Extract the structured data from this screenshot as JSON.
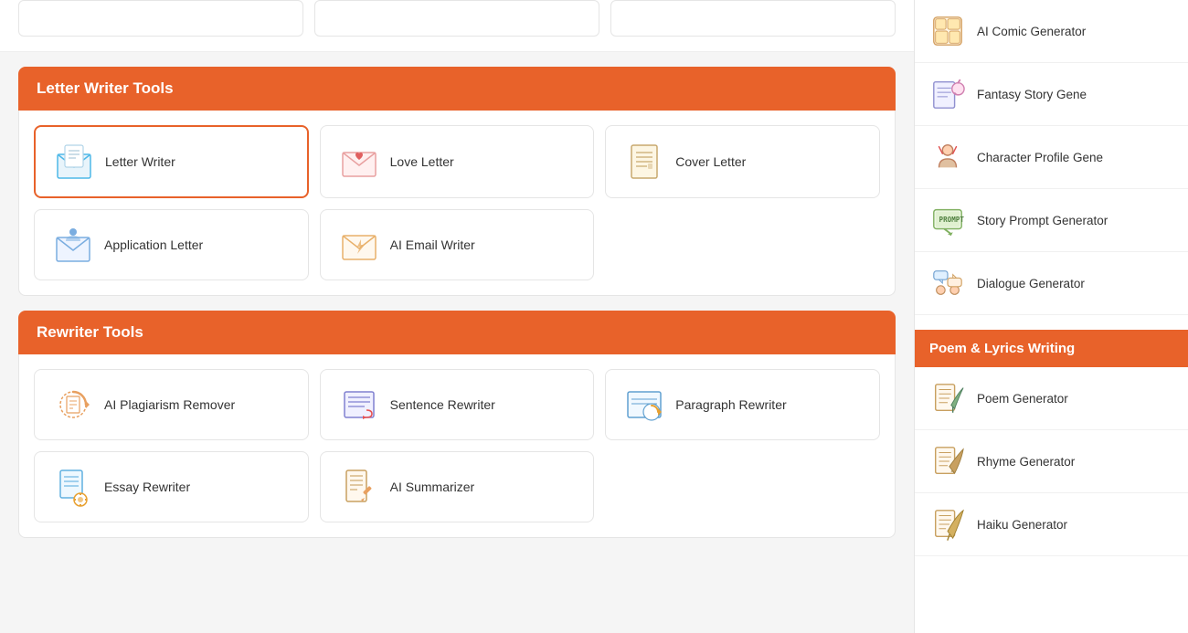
{
  "topCards": [
    {
      "id": "card1"
    },
    {
      "id": "card2"
    },
    {
      "id": "card3"
    }
  ],
  "letterSection": {
    "header": "Letter Writer Tools",
    "tools": [
      {
        "id": "letter-writer",
        "label": "Letter Writer",
        "active": true
      },
      {
        "id": "love-letter",
        "label": "Love Letter",
        "active": false
      },
      {
        "id": "cover-letter",
        "label": "Cover Letter",
        "active": false
      },
      {
        "id": "application-letter",
        "label": "Application Letter",
        "active": false
      },
      {
        "id": "ai-email-writer",
        "label": "AI Email Writer",
        "active": false
      }
    ]
  },
  "rewriterSection": {
    "header": "Rewriter Tools",
    "tools": [
      {
        "id": "ai-plagiarism",
        "label": "AI Plagiarism Remover",
        "active": false
      },
      {
        "id": "sentence-rewriter",
        "label": "Sentence Rewriter",
        "active": false
      },
      {
        "id": "paragraph-rewriter",
        "label": "Paragraph Rewriter",
        "active": false
      },
      {
        "id": "essay-rewriter",
        "label": "Essay Rewriter",
        "active": false
      },
      {
        "id": "ai-summarizer",
        "label": "AI Summarizer",
        "active": false
      }
    ]
  },
  "sidebar": {
    "storySection": {
      "items": [
        {
          "id": "ai-comic",
          "label": "AI Comic Generator"
        },
        {
          "id": "fantasy-story",
          "label": "Fantasy Story Gene"
        },
        {
          "id": "character-profile",
          "label": "Character Profile Gene"
        },
        {
          "id": "story-prompt",
          "label": "Story Prompt Generator"
        },
        {
          "id": "dialogue",
          "label": "Dialogue Generator"
        }
      ]
    },
    "poemSection": {
      "header": "Poem & Lyrics Writing",
      "items": [
        {
          "id": "poem-generator",
          "label": "Poem Generator"
        },
        {
          "id": "rhyme-generator",
          "label": "Rhyme Generator"
        },
        {
          "id": "haiku-generator",
          "label": "Haiku Generator"
        }
      ]
    }
  }
}
